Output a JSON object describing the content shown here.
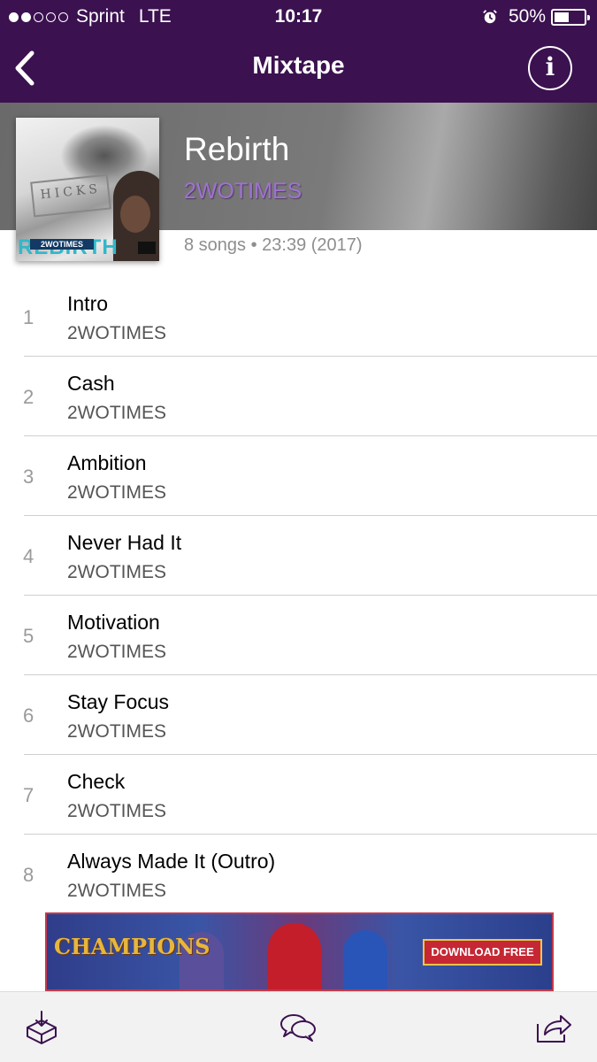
{
  "status_bar": {
    "carrier": "Sprint",
    "network": "LTE",
    "time": "10:17",
    "battery_percent": "50%",
    "battery_level": 0.5,
    "signal_bars_filled": 2,
    "signal_bars_total": 5
  },
  "nav": {
    "title": "Mixtape",
    "back_icon": "chevron-left-icon",
    "info_label": "i"
  },
  "album": {
    "title": "Rebirth",
    "artist": "2WOTIMES",
    "meta": "8 songs • 23:39 (2017)",
    "cover": {
      "wall_text": "HICKS",
      "title_text": "REBIRTH",
      "artist_text": "2WOTIMES"
    }
  },
  "tracks": [
    {
      "number": "1",
      "title": "Intro",
      "artist": "2WOTIMES"
    },
    {
      "number": "2",
      "title": "Cash",
      "artist": "2WOTIMES"
    },
    {
      "number": "3",
      "title": "Ambition",
      "artist": "2WOTIMES"
    },
    {
      "number": "4",
      "title": "Never Had It",
      "artist": "2WOTIMES"
    },
    {
      "number": "5",
      "title": "Motivation",
      "artist": "2WOTIMES"
    },
    {
      "number": "6",
      "title": "Stay Focus",
      "artist": "2WOTIMES"
    },
    {
      "number": "7",
      "title": "Check",
      "artist": "2WOTIMES"
    },
    {
      "number": "8",
      "title": "Always Made It (Outro)",
      "artist": "2WOTIMES"
    }
  ],
  "ad": {
    "logo_text": "CHAMPIONS",
    "cta_text": "DOWNLOAD FREE"
  },
  "toolbar": {
    "download_icon": "download-box-icon",
    "comments_icon": "chat-bubbles-icon",
    "share_icon": "share-icon"
  },
  "colors": {
    "header_bg": "#3b1150",
    "artist_accent": "#9f72d0",
    "meta_text": "#8e8e8e",
    "ad_border": "#c33a4a"
  }
}
